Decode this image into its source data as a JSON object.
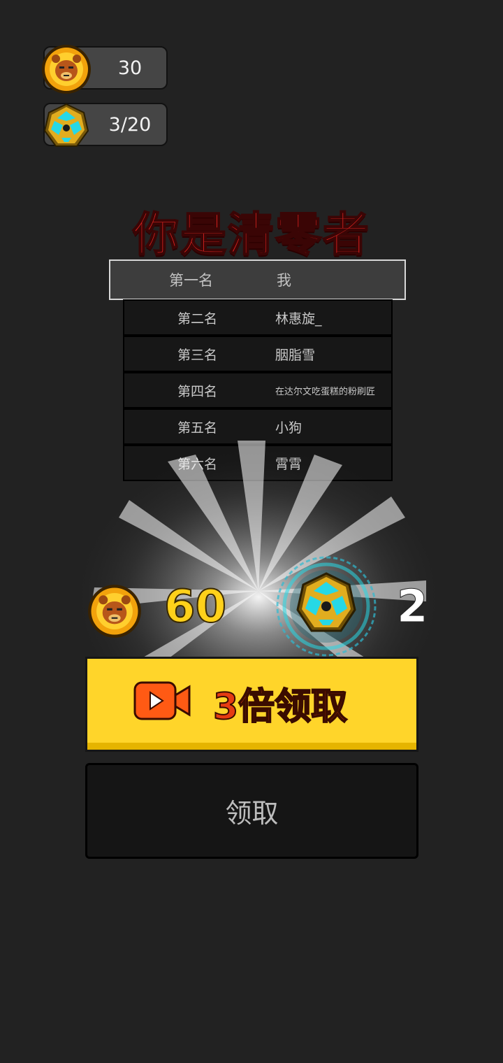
{
  "currency": {
    "coins": {
      "icon": "bear-coin-icon",
      "value": "30"
    },
    "gems": {
      "icon": "gem-icon",
      "value": "3/20"
    }
  },
  "title": "你是清零者",
  "ranking": [
    {
      "rank": "第一名",
      "name": "我",
      "is_self": true
    },
    {
      "rank": "第二名",
      "name": "林惠旋_"
    },
    {
      "rank": "第三名",
      "name": "胭脂雪"
    },
    {
      "rank": "第四名",
      "name": "在达尔文吃蛋糕的粉刷匠"
    },
    {
      "rank": "第五名",
      "name": "小狗"
    },
    {
      "rank": "第六名",
      "name": "霄霄"
    }
  ],
  "rewards": {
    "coins": {
      "icon": "bear-coin-icon",
      "amount": "60"
    },
    "gems": {
      "icon": "gem-icon",
      "amount": "2"
    }
  },
  "buttons": {
    "triple_claim": {
      "icon": "video-play-icon",
      "label": "3倍领取"
    },
    "claim": {
      "label": "领取"
    }
  },
  "colors": {
    "background": "#222222",
    "title": "#d8221f",
    "triple_button": "#ffd52a",
    "triple_label": "#e53c12",
    "coin_amount": "#ffd11a"
  }
}
